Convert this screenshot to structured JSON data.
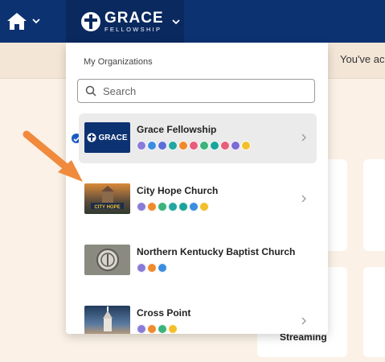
{
  "topbar": {
    "home_icon": "home-icon",
    "brand": {
      "line1": "GRACE",
      "line2": "FELLOWSHIP"
    }
  },
  "notice_text": "You've ac",
  "card_label": "Streaming",
  "dropdown": {
    "title": "My Organizations",
    "search_placeholder": "Search",
    "organizations": [
      {
        "name": "Grace Fellowship",
        "selected": true,
        "thumb_text": "GRACE",
        "icon_colors": [
          "#8a7bd8",
          "#3b8de0",
          "#5c6fd6",
          "#22a6a0",
          "#f08a2c",
          "#e85d7a",
          "#3bb37a",
          "#1aa39a",
          "#e85d7a",
          "#7b6bd6",
          "#f2c02c"
        ]
      },
      {
        "name": "City Hope Church",
        "selected": false,
        "thumb_text": "CITY HOPE",
        "icon_colors": [
          "#8a7bd8",
          "#f08a2c",
          "#3bb37a",
          "#22a6a0",
          "#1aa39a",
          "#3b8de0",
          "#f2c02c"
        ]
      },
      {
        "name": "Northern Kentucky Baptist Church",
        "selected": false,
        "thumb_text": "",
        "icon_colors": [
          "#8a7bd8",
          "#f08a2c",
          "#3b8de0"
        ]
      },
      {
        "name": "Cross Point",
        "selected": false,
        "thumb_text": "",
        "icon_colors": [
          "#8a7bd8",
          "#f08a2c",
          "#3bb37a",
          "#f2c02c"
        ]
      }
    ]
  },
  "colors": {
    "topbar": "#0d3272",
    "accent": "#1b5bc4",
    "arrow": "#f08a3c",
    "page_bg": "#fbf1e6"
  }
}
